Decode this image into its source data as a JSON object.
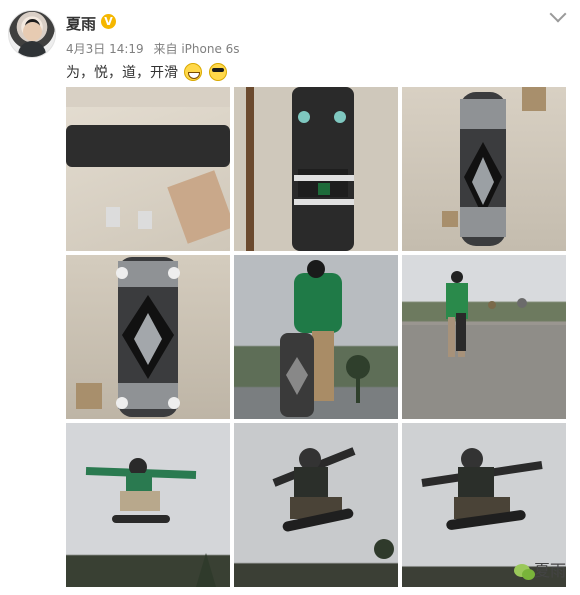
{
  "post": {
    "username": "夏雨",
    "badge": "V",
    "date": "4月3日 14:19",
    "source": "来自 iPhone 6s",
    "text": "为，悦，道，开滑",
    "emojis": [
      "grin-emoji",
      "sunglasses-emoji"
    ]
  },
  "photos": [
    "skateboard-deck-closeup",
    "skateboard-underside-trucks",
    "skateboard-deck-graphic",
    "skateboard-deck-graphic-2",
    "skater-holding-board-low-angle",
    "skater-standing-plaza",
    "skater-ollie-1",
    "skater-ollie-2",
    "skater-ollie-3"
  ],
  "watermark": "夏雨",
  "colors": {
    "username": "#333333",
    "meta": "#808080",
    "badge": "#f5b700"
  }
}
